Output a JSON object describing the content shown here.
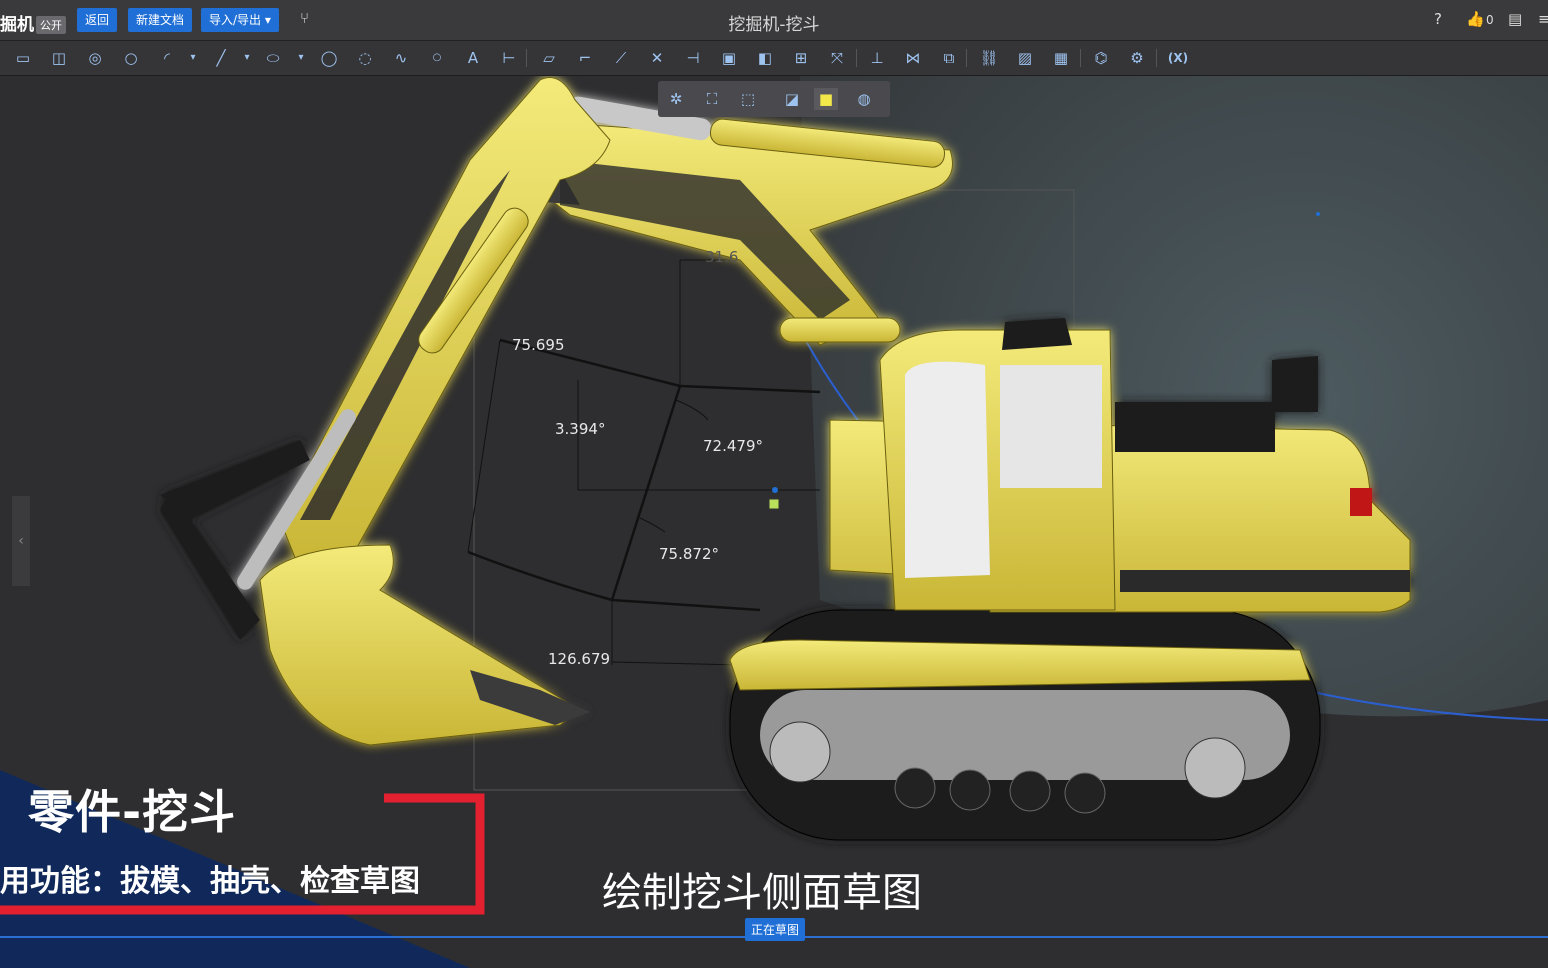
{
  "app": {
    "name": "掘机",
    "badge": "公开",
    "title": "挖掘机-挖斗"
  },
  "top_buttons": {
    "back": "返回",
    "new_doc": "新建文档",
    "import_export": "导入/导出"
  },
  "top_right": {
    "like_count": "0"
  },
  "toolbar": {
    "fx_label": "(X)"
  },
  "dimensions": {
    "d1": "31.6",
    "d2": "75.695",
    "d3": "3.394°",
    "d4": "72.479°",
    "d5": "75.872°",
    "d6": "126.679"
  },
  "caption": {
    "title": "零件-挖斗",
    "subtitle": "用功能：拔模、抽壳、检查草图"
  },
  "video_subtitle": "绘制挖斗侧面草图",
  "status": {
    "sketch_mode": "正在草图"
  },
  "colors": {
    "accent": "#1f6fd6",
    "machine_yellow": "#e7d84c",
    "red_frame": "#e2202f",
    "navy_banner": "#10295a"
  }
}
